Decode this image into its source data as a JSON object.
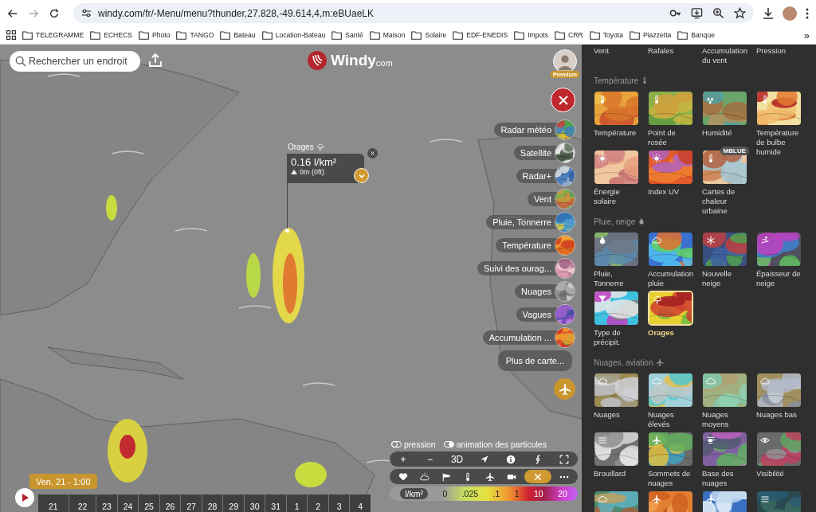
{
  "browser": {
    "url": "windy.com/fr/-Menu/menu?thunder,27.828,-49.614,4,m:eBUaeLK",
    "bookmarks": [
      "TELEGRAMME",
      "ECHECS",
      "Photo",
      "TANGO",
      "Bateau",
      "Location-Bateau",
      "Santé",
      "Maison",
      "Solaire",
      "EDF-ENEDIS",
      "Impots",
      "CRR",
      "Toyota",
      "Piazzetta",
      "Banque"
    ],
    "overflow": "»"
  },
  "map": {
    "search": {
      "placeholder": "Rechercher un endroit"
    },
    "logo": {
      "name": "Windy",
      "suffix": "com"
    },
    "account": {
      "badge": "Premium"
    },
    "layers": [
      {
        "kind": "thumb",
        "label": "Radar météo"
      },
      {
        "kind": "thumb",
        "label": "Satellite"
      },
      {
        "kind": "thumb",
        "label": "Radar+"
      },
      {
        "kind": "thumb",
        "label": "Vent"
      },
      {
        "kind": "thumb",
        "label": "Pluie, Tonnerre"
      },
      {
        "kind": "thumb",
        "label": "Température"
      },
      {
        "kind": "thumb",
        "label": "Suivi des ourag..."
      },
      {
        "kind": "thumb",
        "label": "Nuages"
      },
      {
        "kind": "thumb",
        "label": "Vagues"
      },
      {
        "kind": "thumb",
        "label": "Accumulation ..."
      },
      {
        "kind": "more",
        "label": "Plus de carte..."
      }
    ],
    "popup": {
      "title": "Orages",
      "value": "0.16 l/km²",
      "altitude": "0m (0ft)"
    },
    "toggles": [
      {
        "label": "pression",
        "on": false
      },
      {
        "label": "animation des particules",
        "on": true
      }
    ],
    "zoom_tools": [
      {
        "kind": "text",
        "label": "+"
      },
      {
        "kind": "text",
        "label": "−"
      },
      {
        "kind": "text",
        "label": "3D"
      },
      {
        "kind": "icon"
      },
      {
        "kind": "icon"
      },
      {
        "kind": "icon"
      },
      {
        "kind": "icon"
      }
    ],
    "overlay_tools": [
      {
        "selected": false
      },
      {
        "selected": false
      },
      {
        "selected": false
      },
      {
        "selected": false
      },
      {
        "selected": false
      },
      {
        "selected": false
      },
      {
        "selected": true
      },
      {
        "selected": false
      }
    ],
    "legend": {
      "unit": "l/km²",
      "ticks": [
        "0",
        ".025",
        ".1",
        "1",
        "10",
        "20"
      ]
    },
    "time": {
      "label": "Ven. 21 - 1:00"
    },
    "timeline": {
      "days": [
        "21",
        "22",
        "23",
        "24",
        "25",
        "26",
        "27",
        "28",
        "29",
        "30",
        "31",
        "1",
        "2",
        "3",
        "4"
      ]
    }
  },
  "panel": {
    "top_labels": [
      "Vent",
      "Rafales",
      "Accumulation du vent",
      "Pression"
    ],
    "sections": [
      {
        "title": "Température",
        "tiles": [
          {
            "label": "Température",
            "selected": false
          },
          {
            "label": "Point de rosée",
            "selected": false
          },
          {
            "label": "Humidité",
            "selected": false
          },
          {
            "label": "Température de bulbe humide",
            "selected": false
          },
          {
            "label": "Énergie solaire",
            "selected": false
          },
          {
            "label": "Index UV",
            "selected": false
          },
          {
            "label": "Cartes de chaleur urbaine",
            "selected": false,
            "badge": "MBLUE"
          }
        ]
      },
      {
        "title": "Pluie, neige",
        "tiles": [
          {
            "label": "Pluie, Tonnerre",
            "selected": false
          },
          {
            "label": "Accumulation pluie",
            "selected": false
          },
          {
            "label": "Nouvelle neige",
            "selected": false
          },
          {
            "label": "Épaisseur de neige",
            "selected": false
          },
          {
            "label": "Type de précipit.",
            "selected": false
          },
          {
            "label": "Orages",
            "selected": true
          }
        ]
      },
      {
        "title": "Nuages, aviation",
        "tiles": [
          {
            "label": "Nuages",
            "selected": false
          },
          {
            "label": "Nuages élevés",
            "selected": false
          },
          {
            "label": "Nuages moyens",
            "selected": false
          },
          {
            "label": "Nuages bas",
            "selected": false
          },
          {
            "label": "Brouillard",
            "selected": false
          },
          {
            "label": "Sommets de nuages",
            "selected": false
          },
          {
            "label": "Base des nuages",
            "selected": false
          },
          {
            "label": "Visibilité",
            "selected": false
          },
          {
            "selected": false
          },
          {
            "selected": false
          },
          {
            "selected": false
          },
          {
            "selected": false
          }
        ]
      }
    ]
  }
}
